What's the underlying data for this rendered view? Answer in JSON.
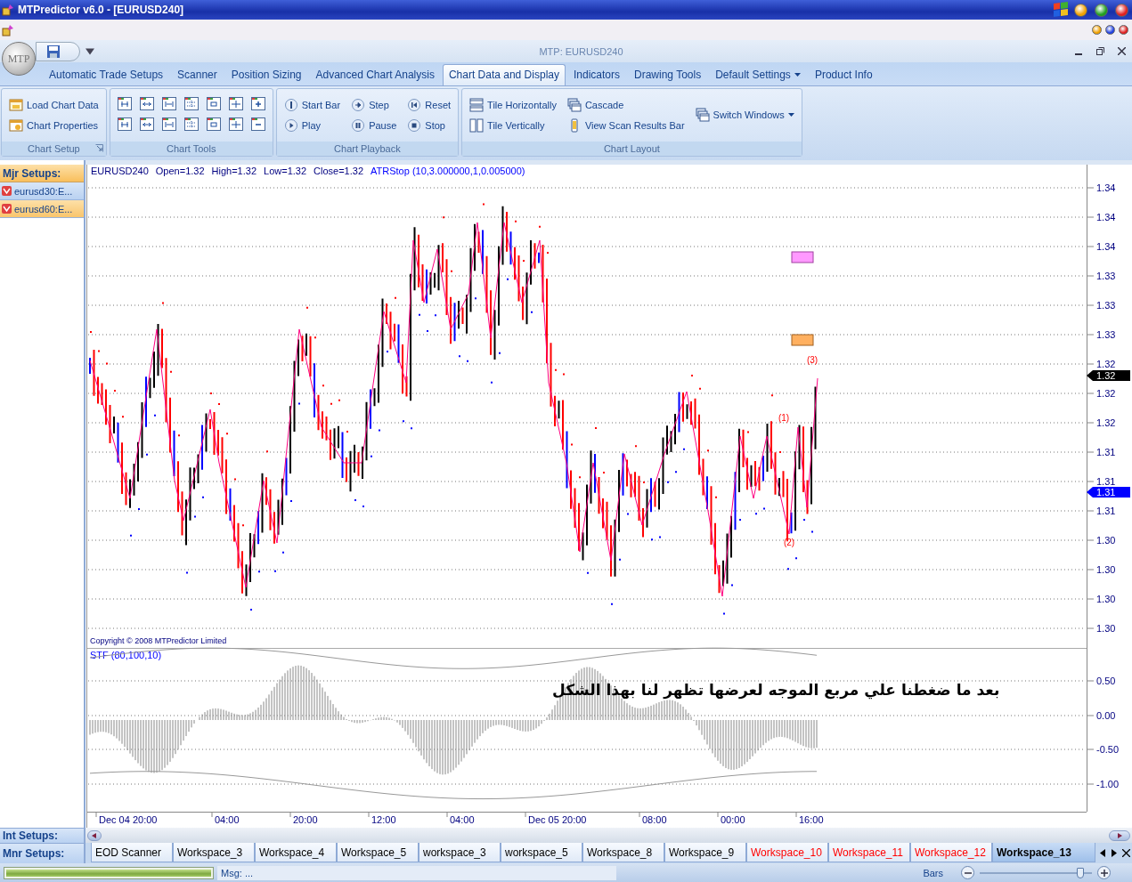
{
  "window": {
    "title": "MTPredictor v6.0 - [EURUSD240]"
  },
  "app_button": "MTP",
  "document_title": "MTP: EURUSD240",
  "ribbon_tabs": [
    {
      "label": "Automatic Trade Setups",
      "selected": false,
      "has_menu": false
    },
    {
      "label": "Scanner",
      "selected": false,
      "has_menu": false
    },
    {
      "label": "Position Sizing",
      "selected": false,
      "has_menu": false
    },
    {
      "label": "Advanced Chart Analysis",
      "selected": false,
      "has_menu": false
    },
    {
      "label": "Chart Data and Display",
      "selected": true,
      "has_menu": false
    },
    {
      "label": "Indicators",
      "selected": false,
      "has_menu": false
    },
    {
      "label": "Drawing Tools",
      "selected": false,
      "has_menu": false
    },
    {
      "label": "Default Settings",
      "selected": false,
      "has_menu": true
    },
    {
      "label": "Product Info",
      "selected": false,
      "has_menu": false
    }
  ],
  "ribbon_groups": [
    {
      "title": "Chart Setup",
      "kind": "commands",
      "launcher": true,
      "items": [
        {
          "label": "Load Chart Data",
          "has_menu": false
        },
        {
          "label": "Chart Properties",
          "has_menu": false
        }
      ]
    },
    {
      "title": "Chart Tools",
      "kind": "icon_grid",
      "launcher": false
    },
    {
      "title": "Chart Playback",
      "kind": "commands",
      "launcher": false,
      "items": [
        {
          "label": "Start Bar",
          "has_menu": false
        },
        {
          "label": "Play",
          "has_menu": false
        },
        {
          "label": "Step",
          "has_menu": false
        },
        {
          "label": "Pause",
          "has_menu": false
        },
        {
          "label": "Reset",
          "has_menu": false
        },
        {
          "label": "Stop",
          "has_menu": false
        }
      ]
    },
    {
      "title": "Chart Layout",
      "kind": "commands",
      "launcher": false,
      "items": [
        {
          "label": "Tile Horizontally",
          "has_menu": false
        },
        {
          "label": "Tile Vertically",
          "has_menu": false
        },
        {
          "label": "Cascade",
          "has_menu": false
        },
        {
          "label": "View Scan Results Bar",
          "has_menu": false
        },
        {
          "label": "Switch Windows",
          "has_menu": true
        }
      ]
    }
  ],
  "sidebar": {
    "title": "Mjr Setups:",
    "items": [
      {
        "label": "eurusd30:E...",
        "selected": false
      },
      {
        "label": "eurusd60:E...",
        "selected": true
      }
    ],
    "bottom_sections": [
      "Int Setups:",
      "Mnr Setups:"
    ]
  },
  "chart": {
    "fields": [
      "EURUSD240",
      "Open=1.32",
      "High=1.32",
      "Low=1.32",
      "Close=1.32"
    ],
    "indicator": "ATRStop (10,3.000000,1,0.005000)",
    "price_ticks": [
      "1.34",
      "1.34",
      "1.34",
      "1.33",
      "1.33",
      "1.33",
      "1.32",
      "1.32",
      "1.32",
      "1.31",
      "1.31",
      "1.31",
      "1.30",
      "1.30",
      "1.30",
      "1.30"
    ],
    "last_price": "1.32",
    "marker_price": "1.31",
    "wave_labels": [
      "(1)",
      "(2)",
      "(3)"
    ],
    "copyright": "Copyright © 2008 MTPredictor Limited",
    "oscillator": {
      "title": "STF (80,100,10)",
      "ticks": [
        "0.50",
        "0.00",
        "-0.50",
        "-1.00"
      ]
    },
    "time_labels": [
      "Dec 04 20:00",
      "04:00",
      "20:00",
      "12:00",
      "04:00",
      "Dec 05 20:00",
      "08:00",
      "00:00",
      "16:00"
    ],
    "annotation": "بعد ما ضغطنا علي مربع الموجه لعرضها تظهر لنا بهذا الشكل"
  },
  "bottom_tabs": [
    {
      "label": "EOD Scanner",
      "color": "#000000",
      "selected": false
    },
    {
      "label": "Workspace_3",
      "color": "#000000",
      "selected": false
    },
    {
      "label": "Workspace_4",
      "color": "#000000",
      "selected": false
    },
    {
      "label": "Workspace_5",
      "color": "#000000",
      "selected": false
    },
    {
      "label": "workspace_3",
      "color": "#000000",
      "selected": false
    },
    {
      "label": "workspace_5",
      "color": "#000000",
      "selected": false
    },
    {
      "label": "Workspace_8",
      "color": "#000000",
      "selected": false
    },
    {
      "label": "Workspace_9",
      "color": "#000000",
      "selected": false
    },
    {
      "label": "Workspace_10",
      "color": "#ff0000",
      "selected": false
    },
    {
      "label": "Workspace_11",
      "color": "#ff0000",
      "selected": false
    },
    {
      "label": "Workspace_12",
      "color": "#ff0000",
      "selected": false
    },
    {
      "label": "Workspace_13",
      "color": "#000000",
      "selected": true
    }
  ],
  "status_bar": {
    "progress": {
      "level": 1
    },
    "message": "Msg: ...",
    "bars": {
      "label": "Bars",
      "level": 0.9
    }
  }
}
